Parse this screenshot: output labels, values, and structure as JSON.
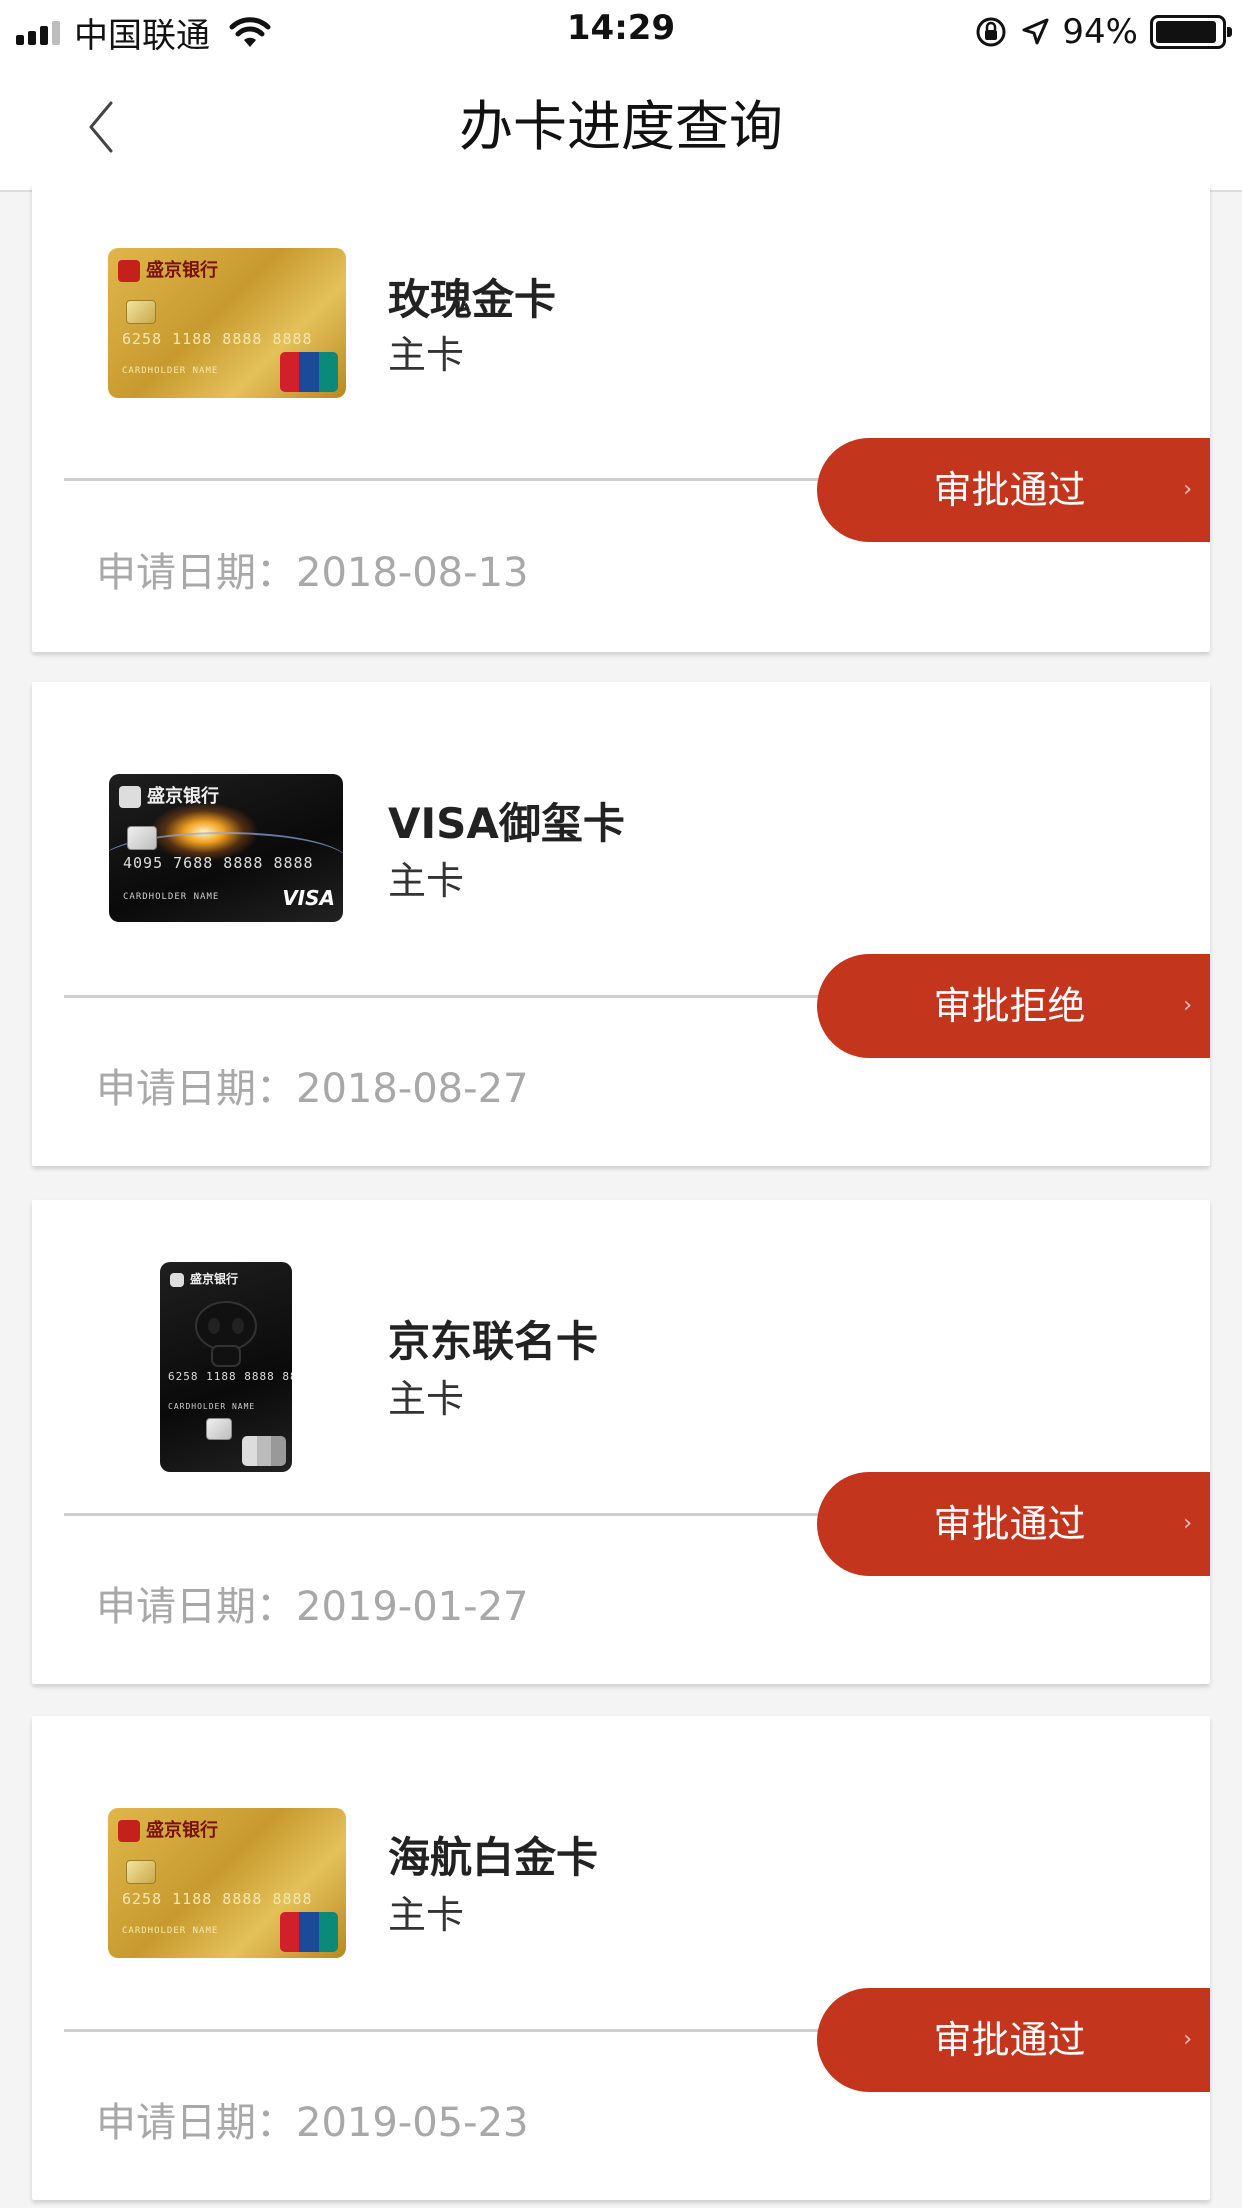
{
  "status_bar": {
    "carrier": "中国联通",
    "time": "14:29",
    "battery": "94%",
    "battery_level": 0.94,
    "icons": [
      "signal-icon",
      "wifi-icon",
      "orientation-lock-icon",
      "location-arrow-icon",
      "battery-icon"
    ]
  },
  "nav": {
    "title": "办卡进度查询",
    "back_icon": "chevron-left-icon"
  },
  "date_label": "申请日期：",
  "applications": [
    {
      "card_name": "玫瑰金卡",
      "card_type": "主卡",
      "status": "审批通过",
      "date": "2018-08-13",
      "card_art": "gold-unionpay-card"
    },
    {
      "card_name": "VISA御玺卡",
      "card_type": "主卡",
      "status": "审批拒绝",
      "date": "2018-08-27",
      "card_art": "black-visa-card"
    },
    {
      "card_name": "京东联名卡",
      "card_type": "主卡",
      "status": "审批通过",
      "date": "2019-01-27",
      "card_art": "black-vertical-jd-card"
    },
    {
      "card_name": "海航白金卡",
      "card_type": "主卡",
      "status": "审批通过",
      "date": "2019-05-23",
      "card_art": "gold-unionpay-card"
    }
  ],
  "colors": {
    "status_button": "#c4351e",
    "date_text": "#a8a8a8",
    "background": "#f4f4f4"
  }
}
